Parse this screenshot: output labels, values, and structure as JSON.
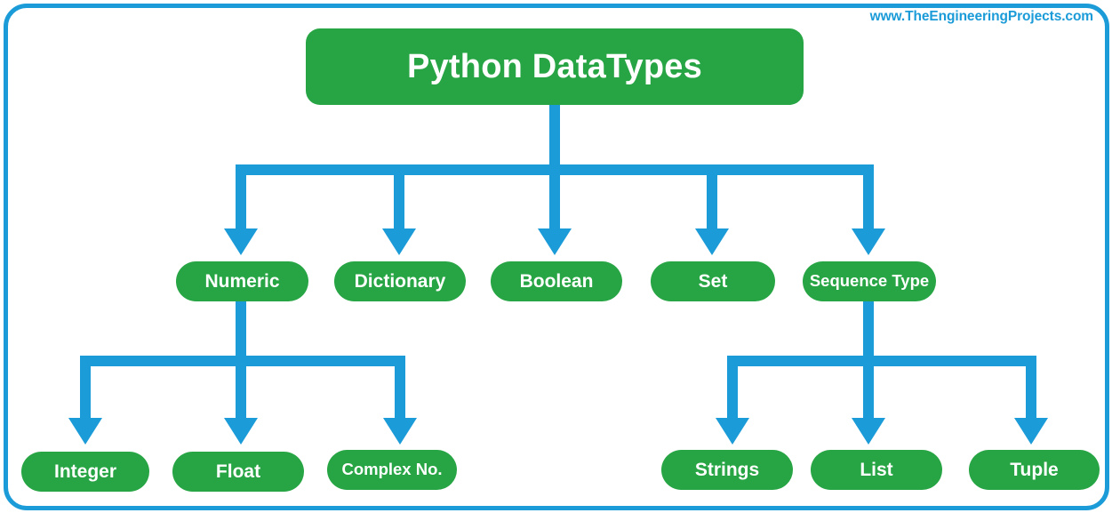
{
  "watermark": "www.TheEngineeringProjects.com",
  "colors": {
    "node_fill": "#27a544",
    "connector": "#1b9bd8",
    "frame": "#1b9bd8",
    "node_text": "#ffffff",
    "background": "#ffffff"
  },
  "diagram": {
    "type": "tree",
    "root": {
      "label": "Python DataTypes"
    },
    "level2": [
      {
        "label": "Numeric"
      },
      {
        "label": "Dictionary"
      },
      {
        "label": "Boolean"
      },
      {
        "label": "Set"
      },
      {
        "label": "Sequence Type"
      }
    ],
    "numeric_children": [
      {
        "label": "Integer"
      },
      {
        "label": "Float"
      },
      {
        "label": "Complex No."
      }
    ],
    "sequence_children": [
      {
        "label": "Strings"
      },
      {
        "label": "List"
      },
      {
        "label": "Tuple"
      }
    ]
  }
}
